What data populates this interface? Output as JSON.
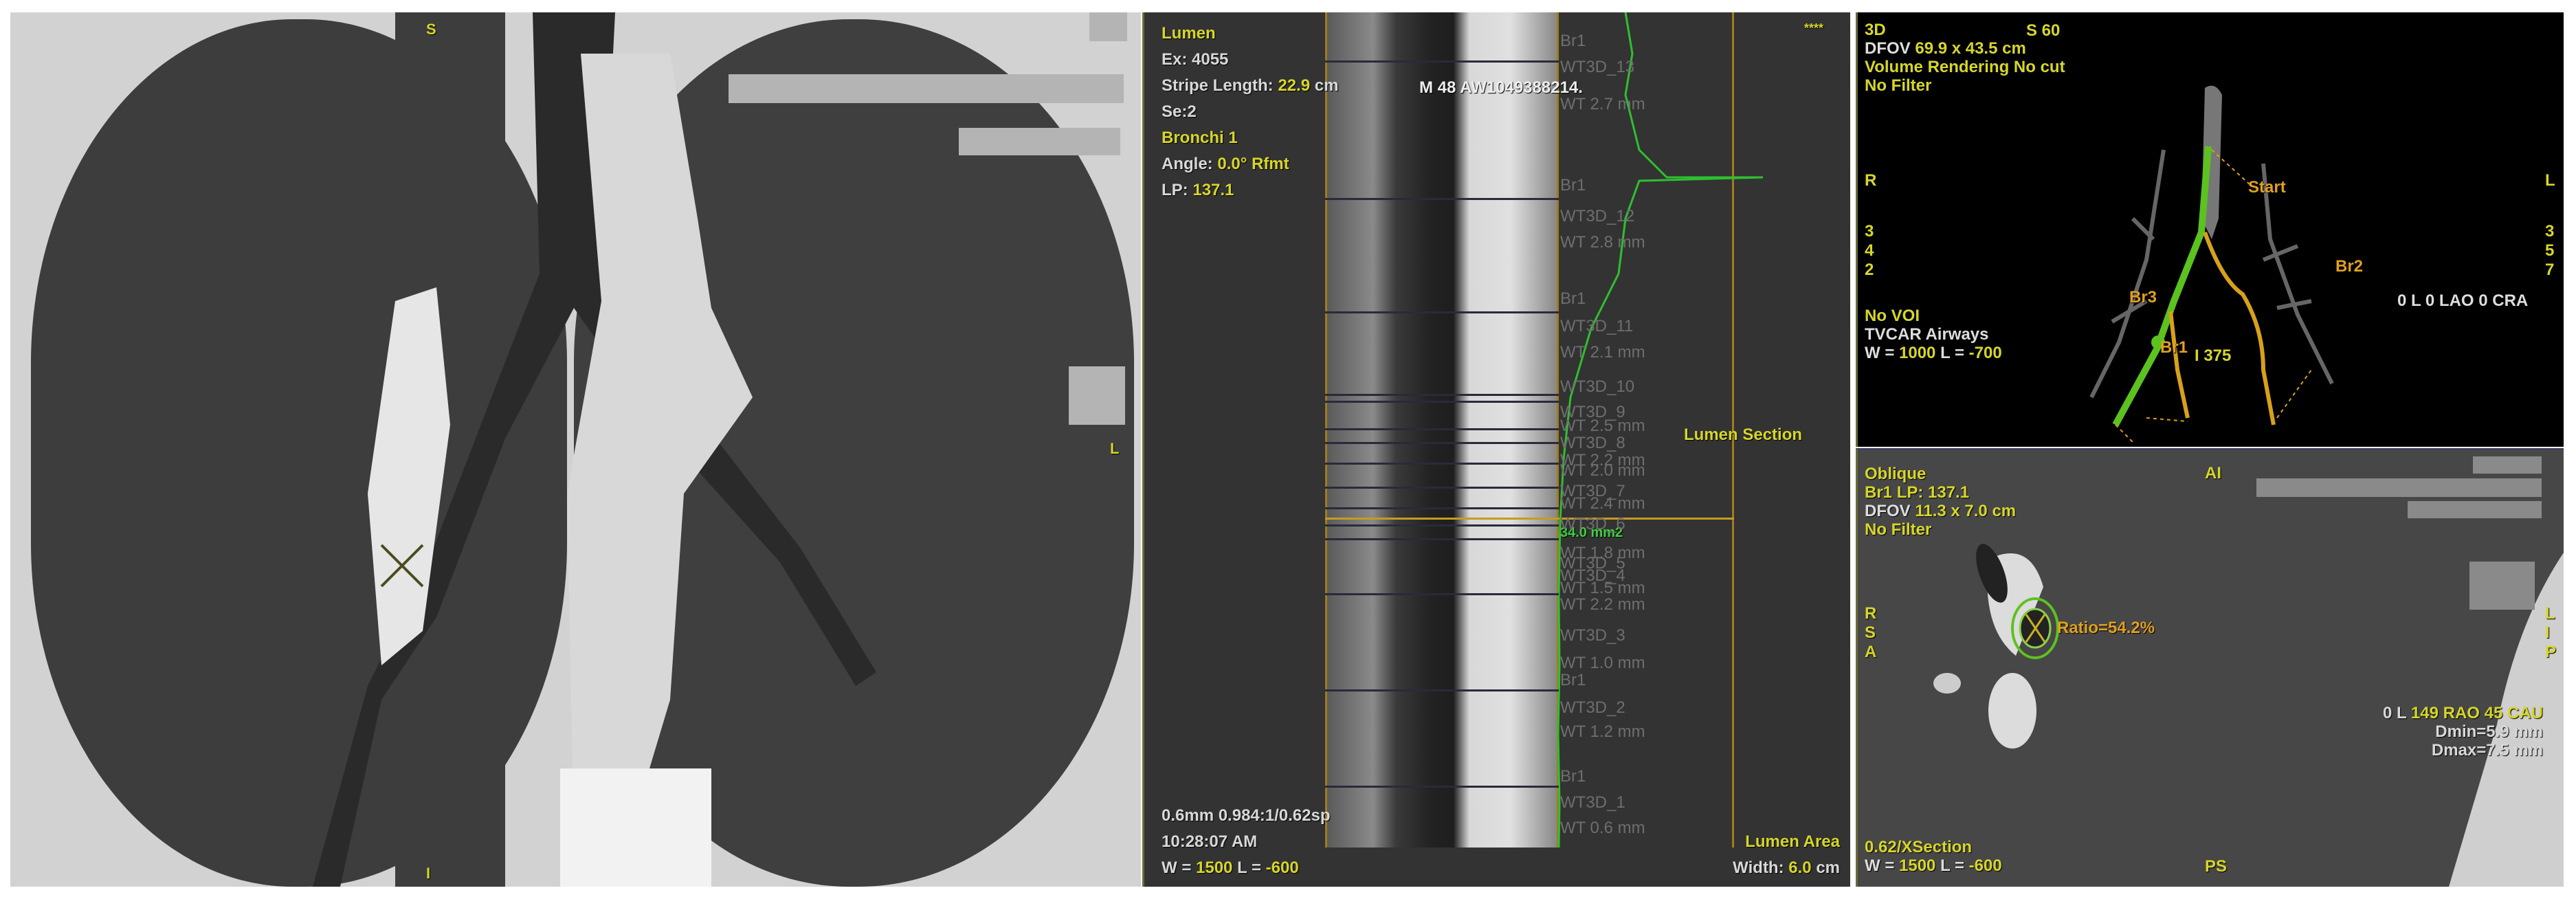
{
  "coronal": {
    "orient_top": "S",
    "orient_right": "L",
    "orient_bottom": "I"
  },
  "lumen_view": {
    "title": "Lumen",
    "exam": "Ex: 4055",
    "stripe_label": "Stripe Length:",
    "stripe_value": "22.9",
    "stripe_unit": "cm",
    "series": "Se:2",
    "bronchi": "Bronchi 1",
    "angle_label": "Angle:",
    "angle_value": "0.0° Rfmt",
    "lp_label": "LP:",
    "lp_value": "137.1",
    "patient": "M 48 AW1049388214.",
    "stars": "****",
    "lumen_section": "Lumen Section",
    "slice_info": "0.6mm 0.984:1/0.62sp",
    "time": "10:28:07 AM",
    "w_label": "W =",
    "w_value": "1500",
    "l_label": "L =",
    "l_value": "-600",
    "lumen_area": "Lumen Area",
    "width_label": "Width:",
    "width_value": "6.0",
    "width_unit": "cm",
    "area_readout": "34.0 mm2",
    "markers": [
      "Br1",
      "WT3D_13",
      "WT 2.7 mm",
      "Br1",
      "WT3D_12",
      "WT 2.8 mm",
      "Br1",
      "WT3D_11",
      "WT 2.1 mm",
      "WT3D_10",
      "WT3D_9",
      "WT 2.5 mm",
      "WT3D_8",
      "WT 2.2 mm",
      "WT 2.0 mm",
      "WT3D_7",
      "WT 2.4 mm",
      "WT3D_6",
      "WT 1.8 mm",
      "WT3D_5",
      "WT3D_4",
      "WT 1.5 mm",
      "WT 2.2 mm",
      "WT3D_3",
      "WT 1.0 mm",
      "Br1",
      "WT3D_2",
      "WT 1.2 mm",
      "Br1",
      "WT3D_1",
      "WT 0.6 mm"
    ]
  },
  "view3d": {
    "title": "3D",
    "orient_top": "S 60",
    "dfov_label": "DFOV",
    "dfov_value": "69.9 x 43.5 cm",
    "render": "Volume Rendering No cut",
    "filter": "No Filter",
    "left": "R",
    "right": "L",
    "left_nums": [
      "3",
      "4",
      "2"
    ],
    "right_nums": [
      "3",
      "5",
      "7"
    ],
    "start": "Start",
    "br1": "Br1",
    "br2": "Br2",
    "br3": "Br3",
    "angles": "0 L 0 LAO 0 CRA",
    "voi": "No VOI",
    "protocol": "TVCAR Airways",
    "w_label": "W =",
    "w_value": "1000",
    "l_label": "L =",
    "l_value": "-700",
    "bottom": "I 375"
  },
  "oblique": {
    "title": "Oblique",
    "lp": "Br1 LP: 137.1",
    "dfov_label": "DFOV",
    "dfov_value": "11.3 x 7.0 cm",
    "filter": "No Filter",
    "orient_top": "AI",
    "left": [
      "R",
      "S",
      "A"
    ],
    "right": [
      "L",
      "I",
      "P"
    ],
    "ratio": "Ratio=54.2%",
    "angles_prefix": "0 L",
    "angles": "149 RAO 45 CAU",
    "dmin": "Dmin=5.9 mm",
    "dmax": "Dmax=7.5 mm",
    "section": "0.62/XSection",
    "w_label": "W =",
    "w_value": "1500",
    "l_label": "L =",
    "l_value": "-600",
    "orient_bottom": "PS"
  }
}
